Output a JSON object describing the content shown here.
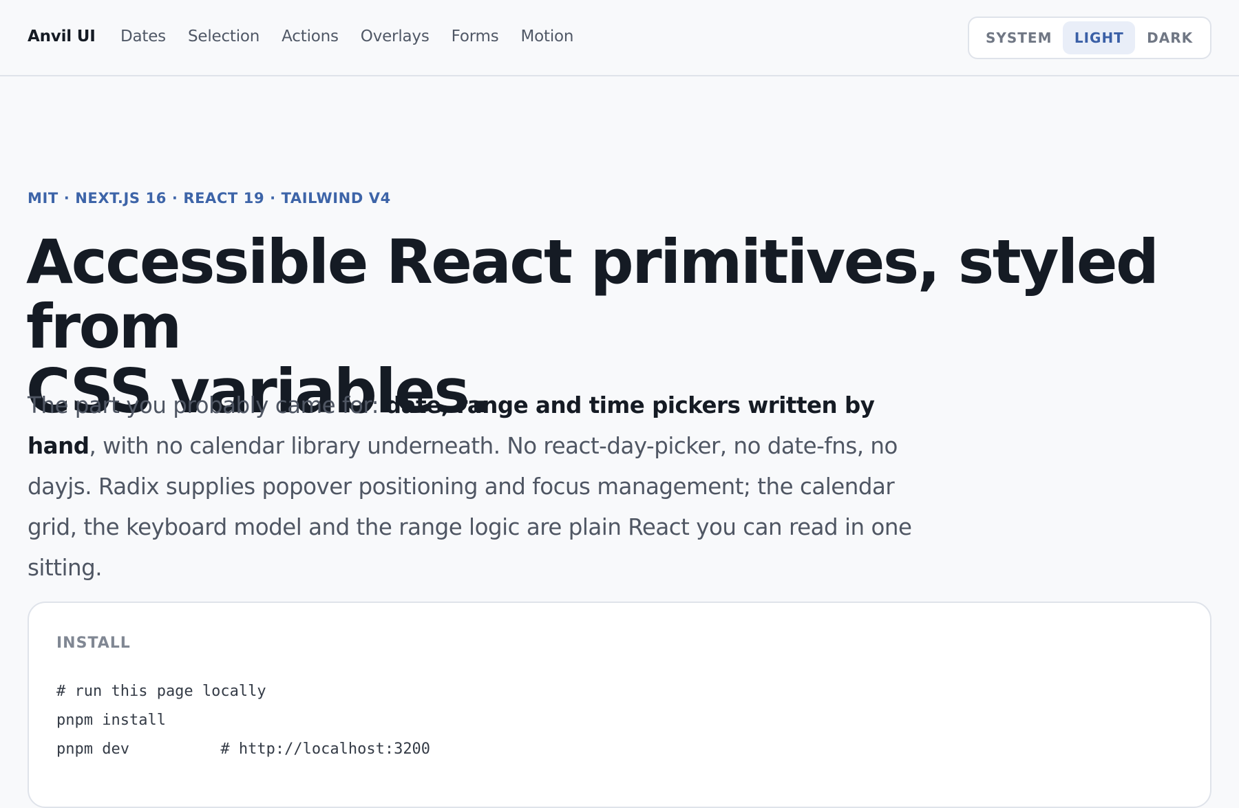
{
  "header": {
    "brand": "Anvil UI",
    "nav": [
      {
        "label": "Dates"
      },
      {
        "label": "Selection"
      },
      {
        "label": "Actions"
      },
      {
        "label": "Overlays"
      },
      {
        "label": "Forms"
      },
      {
        "label": "Motion"
      }
    ],
    "theme": {
      "options": [
        "SYSTEM",
        "LIGHT",
        "DARK"
      ],
      "selected": "LIGHT"
    }
  },
  "hero": {
    "eyebrow": "MIT · NEXT.JS 16 · REACT 19 · TAILWIND V4",
    "title_line1": "Accessible React primitives, styled from",
    "title_line2": "CSS variables.",
    "body_intro": "The part you probably came for: ",
    "body_bold": "date, range and time pickers written by hand",
    "body_rest": ", with no calendar library underneath. No react-day-picker, no date-fns, no dayjs. Radix supplies popover positioning and focus management; the calendar grid, the keyboard model and the range logic are plain React you can read in one sitting."
  },
  "install": {
    "label": "INSTALL",
    "lines": [
      "# run this page locally",
      "pnpm install",
      "pnpm dev          # http://localhost:3200"
    ]
  },
  "colors": {
    "accent": "#3d64a8",
    "selected_bg": "#e9eef8",
    "border": "#dfe3ea",
    "text_primary": "#151b24",
    "text_secondary": "#4f5663"
  }
}
